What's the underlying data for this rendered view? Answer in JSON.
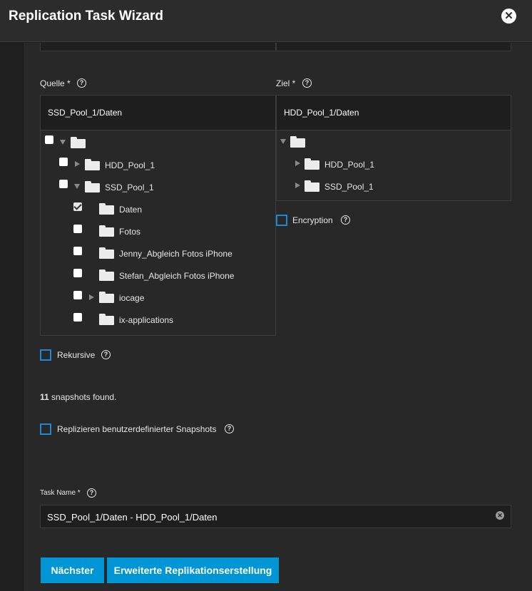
{
  "dialog": {
    "title": "Replication Task Wizard"
  },
  "source": {
    "label": "Quelle *",
    "path": "SSD_Pool_1/Daten",
    "tree": {
      "root_checked": false,
      "pools": [
        {
          "label": "HDD_Pool_1",
          "checked": false,
          "expanded": false
        },
        {
          "label": "SSD_Pool_1",
          "checked": false,
          "expanded": true
        }
      ],
      "children": [
        {
          "label": "Daten",
          "checked": true,
          "has_children": false
        },
        {
          "label": "Fotos",
          "checked": false,
          "has_children": false
        },
        {
          "label": "Jenny_Abgleich Fotos iPhone",
          "checked": false,
          "has_children": false
        },
        {
          "label": "Stefan_Abgleich Fotos iPhone",
          "checked": false,
          "has_children": false
        },
        {
          "label": "iocage",
          "checked": false,
          "has_children": true
        },
        {
          "label": "ix-applications",
          "checked": false,
          "has_children": false
        }
      ]
    }
  },
  "target": {
    "label": "Ziel *",
    "path": "HDD_Pool_1/Daten",
    "pools": [
      "HDD_Pool_1",
      "SSD_Pool_1"
    ]
  },
  "options": {
    "encryption": "Encryption",
    "recursive": "Rekursive",
    "custom_snapshots": "Replizieren benutzerdefinierter Snapshots"
  },
  "snapshots": {
    "count": "11",
    "text": "snapshots found."
  },
  "task_name": {
    "label": "Task Name *",
    "value": "SSD_Pool_1/Daten - HDD_Pool_1/Daten"
  },
  "buttons": {
    "next": "Nächster",
    "advanced": "Erweiterte Replikationserstellung"
  },
  "colors": {
    "accent": "#0095d5",
    "checkbox_outline": "#1f8ad1",
    "background": "#282828"
  }
}
